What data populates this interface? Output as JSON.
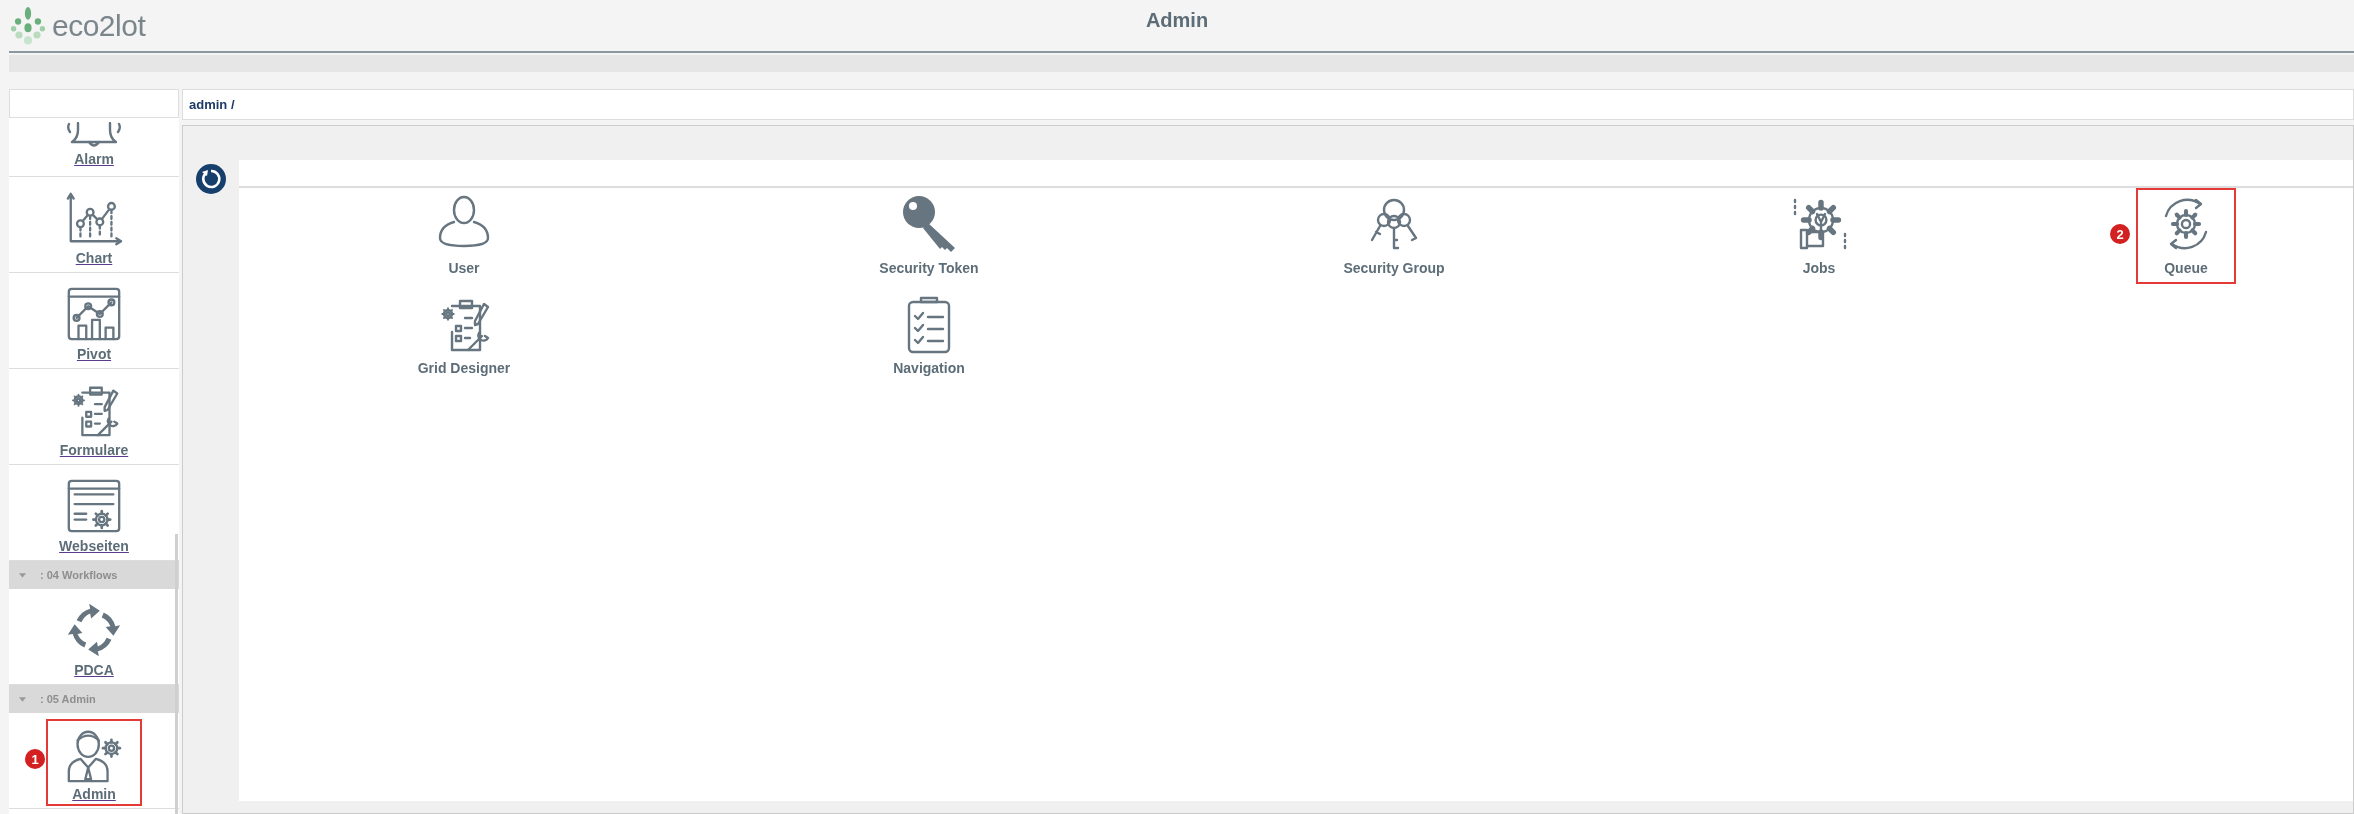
{
  "header": {
    "logo_text": "eco2lot",
    "title": "Admin"
  },
  "sidebar": {
    "items": [
      {
        "kind": "item",
        "label": "Alarm",
        "highlighted": false
      },
      {
        "kind": "item",
        "label": "Chart",
        "highlighted": false
      },
      {
        "kind": "item",
        "label": "Pivot",
        "highlighted": false
      },
      {
        "kind": "item",
        "label": "Formulare",
        "highlighted": false
      },
      {
        "kind": "item",
        "label": "Webseiten",
        "highlighted": false
      },
      {
        "kind": "group",
        "label": ": 04 Workflows"
      },
      {
        "kind": "item",
        "label": "PDCA",
        "highlighted": false
      },
      {
        "kind": "group",
        "label": ": 05 Admin"
      },
      {
        "kind": "item",
        "label": "Admin",
        "highlighted": true,
        "marker": "1"
      }
    ]
  },
  "breadcrumb": "admin /",
  "tiles": [
    {
      "label": "User",
      "highlighted": false
    },
    {
      "label": "Security Token",
      "highlighted": false
    },
    {
      "label": "Security Group",
      "highlighted": false
    },
    {
      "label": "Jobs",
      "highlighted": false
    },
    {
      "label": "Queue",
      "highlighted": true,
      "marker": "2"
    },
    {
      "label": "Grid Designer",
      "highlighted": false
    },
    {
      "label": "Navigation",
      "highlighted": false
    }
  ]
}
